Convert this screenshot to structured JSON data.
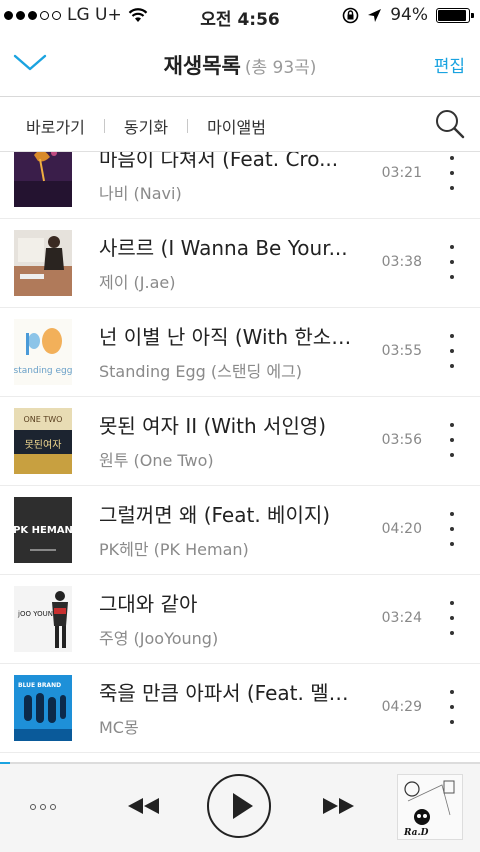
{
  "status_bar": {
    "carrier": "LG U+",
    "time": "오전 4:56",
    "battery_percent": "94%",
    "battery_level": 0.94,
    "signal_bars": 3,
    "signal_total": 5
  },
  "header": {
    "title": "재생목록",
    "count": "(총 93곡)",
    "edit_label": "편집",
    "collapse_icon": "chevron-down-icon"
  },
  "nav": {
    "items": [
      "바로가기",
      "동기화",
      "마이앨범"
    ],
    "search_icon": "search-icon"
  },
  "songs": [
    {
      "title": "마음이 다쳐서 (Feat. Cro...",
      "artist": "나비 (Navi)",
      "duration": "03:21"
    },
    {
      "title": "사르르 (I Wanna Be Your...",
      "artist": "제이 (J.ae)",
      "duration": "03:38"
    },
    {
      "title": "넌 이별 난 아직 (With 한소…",
      "artist": "Standing Egg (스탠딩 에그)",
      "duration": "03:55"
    },
    {
      "title": "못된 여자 II (With 서인영)",
      "artist": "원투 (One Two)",
      "duration": "03:56"
    },
    {
      "title": "그럴꺼면 왜 (Feat. 베이지)",
      "artist": "PK헤만 (PK Heman)",
      "duration": "04:20"
    },
    {
      "title": "그대와 같아",
      "artist": "주영 (JooYoung)",
      "duration": "03:24"
    },
    {
      "title": "죽을 만큼 아파서 (Feat. 멜…",
      "artist": "MC몽",
      "duration": "04:29"
    }
  ],
  "album_art_text": {
    "art_2": "standing egg",
    "art_3": "ONE TWO",
    "art_3b": "못된여자",
    "art_4": "PK HEMAN",
    "art_5": "jOO YOUNg",
    "art_6": "BLUE BRAND",
    "player_art": "Ra.D"
  },
  "player": {
    "progress": 0.02,
    "more_icon": "more-options-icon",
    "prev_icon": "previous-icon",
    "play_icon": "play-icon",
    "next_icon": "next-icon"
  },
  "colors": {
    "accent": "#1aa3e0",
    "text": "#222222",
    "subtext": "#8a8a8a",
    "player_bg": "#f5f5f5"
  }
}
